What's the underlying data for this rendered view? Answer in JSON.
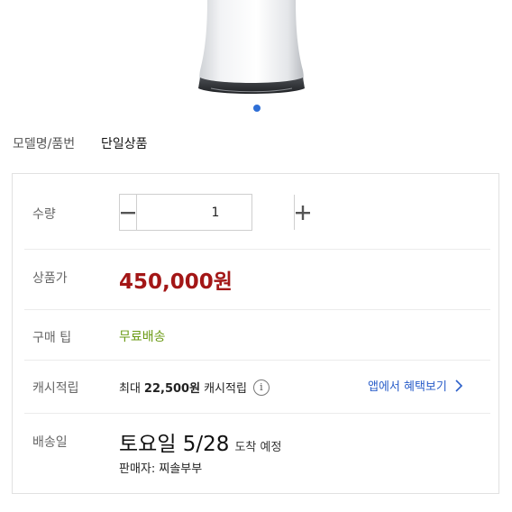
{
  "carousel": {
    "active_index": 0,
    "dot_color": "#2f6fd6"
  },
  "model": {
    "label": "모델명/품번",
    "value": "단일상품"
  },
  "quantity": {
    "label": "수량",
    "value": "1",
    "minus_icon": "minus-icon",
    "plus_icon": "plus-icon"
  },
  "price": {
    "label": "상품가",
    "value": "450,000원",
    "color": "#a31616"
  },
  "tip": {
    "label": "구매 팁",
    "value": "무료배송",
    "color": "#6a9a13"
  },
  "cash": {
    "label": "캐시적립",
    "prefix": "최대",
    "amount": "22,500원",
    "suffix": "캐시적립",
    "info_icon": "info-icon",
    "link_label": "앱에서 혜택보기",
    "link_color": "#2a5ec9"
  },
  "delivery": {
    "label": "배송일",
    "date": "토요일 5/28",
    "suffix": "도착 예정",
    "seller": "판매자: 찌솔부부"
  }
}
